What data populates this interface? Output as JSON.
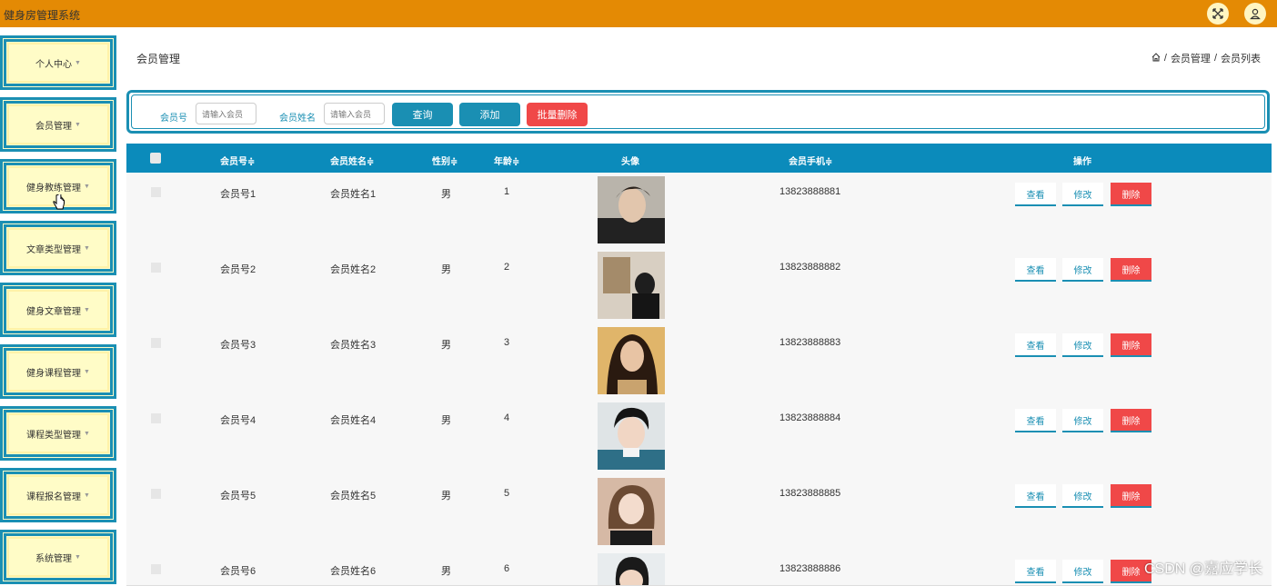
{
  "app": {
    "title": "健身房管理系统"
  },
  "header": {
    "fullscreen_icon": "fullscreen-icon",
    "user_icon": "user-icon"
  },
  "sidebar": {
    "items": [
      {
        "label": "个人中心"
      },
      {
        "label": "会员管理"
      },
      {
        "label": "健身教练管理"
      },
      {
        "label": "文章类型管理"
      },
      {
        "label": "健身文章管理"
      },
      {
        "label": "健身课程管理"
      },
      {
        "label": "课程类型管理"
      },
      {
        "label": "课程报名管理"
      },
      {
        "label": "系统管理"
      }
    ]
  },
  "page": {
    "title": "会员管理"
  },
  "breadcrumb": {
    "items": [
      "会员管理",
      "会员列表"
    ],
    "separator": "/"
  },
  "search": {
    "member_no_label": "会员号",
    "member_no_placeholder": "请输入会员",
    "member_name_label": "会员姓名",
    "member_name_placeholder": "请输入会员",
    "query_label": "查询",
    "add_label": "添加",
    "batch_delete_label": "批量删除"
  },
  "table": {
    "headers": {
      "member_no": "会员号≑",
      "member_name": "会员姓名≑",
      "gender": "性别≑",
      "age": "年龄≑",
      "avatar": "头像",
      "phone": "会员手机≑",
      "actions": "操作"
    },
    "actions": {
      "view": "查看",
      "edit": "修改",
      "delete": "删除"
    },
    "rows": [
      {
        "member_no": "会员号1",
        "member_name": "会员姓名1",
        "gender": "男",
        "age": "1",
        "phone": "13823888881"
      },
      {
        "member_no": "会员号2",
        "member_name": "会员姓名2",
        "gender": "男",
        "age": "2",
        "phone": "13823888882"
      },
      {
        "member_no": "会员号3",
        "member_name": "会员姓名3",
        "gender": "男",
        "age": "3",
        "phone": "13823888883"
      },
      {
        "member_no": "会员号4",
        "member_name": "会员姓名4",
        "gender": "男",
        "age": "4",
        "phone": "13823888884"
      },
      {
        "member_no": "会员号5",
        "member_name": "会员姓名5",
        "gender": "男",
        "age": "5",
        "phone": "13823888885"
      },
      {
        "member_no": "会员号6",
        "member_name": "会员姓名6",
        "gender": "男",
        "age": "6",
        "phone": "13823888886"
      }
    ]
  },
  "watermark": {
    "text": "CSDN @嘉应学长"
  },
  "colors": {
    "topbar": "#e48a04",
    "accent": "#1a8fb3",
    "table_header": "#0b8bbb",
    "danger": "#f04848",
    "sidebar_bg": "#fffbc9"
  }
}
